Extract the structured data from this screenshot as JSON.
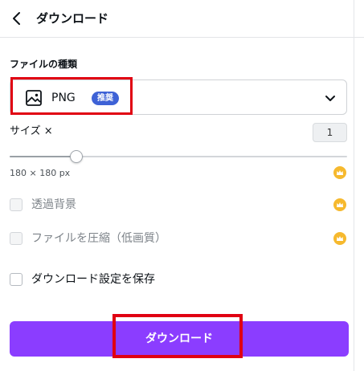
{
  "header": {
    "title": "ダウンロード",
    "back_icon": "chevron-left-icon"
  },
  "file_type": {
    "label": "ファイルの種類",
    "selected_value": "PNG",
    "badge": "推奨",
    "badge_color": "#3e62d6",
    "file_icon": "image-icon",
    "dropdown_icon": "chevron-down-icon"
  },
  "size": {
    "label": "サイズ ×",
    "value": "1",
    "dimensions": "180 × 180 px"
  },
  "options": [
    {
      "label": "透過背景",
      "checked": false,
      "disabled": true,
      "premium": true
    },
    {
      "label": "ファイルを圧縮（低画質）",
      "checked": false,
      "disabled": true,
      "premium": true
    },
    {
      "label": "ダウンロード設定を保存",
      "checked": false,
      "disabled": false,
      "premium": false
    }
  ],
  "download_button": {
    "label": "ダウンロード",
    "color": "#8b3dff"
  },
  "premium_icon": "crown-icon",
  "premium_color": "#f6b92e",
  "highlight_color": "#e00012"
}
